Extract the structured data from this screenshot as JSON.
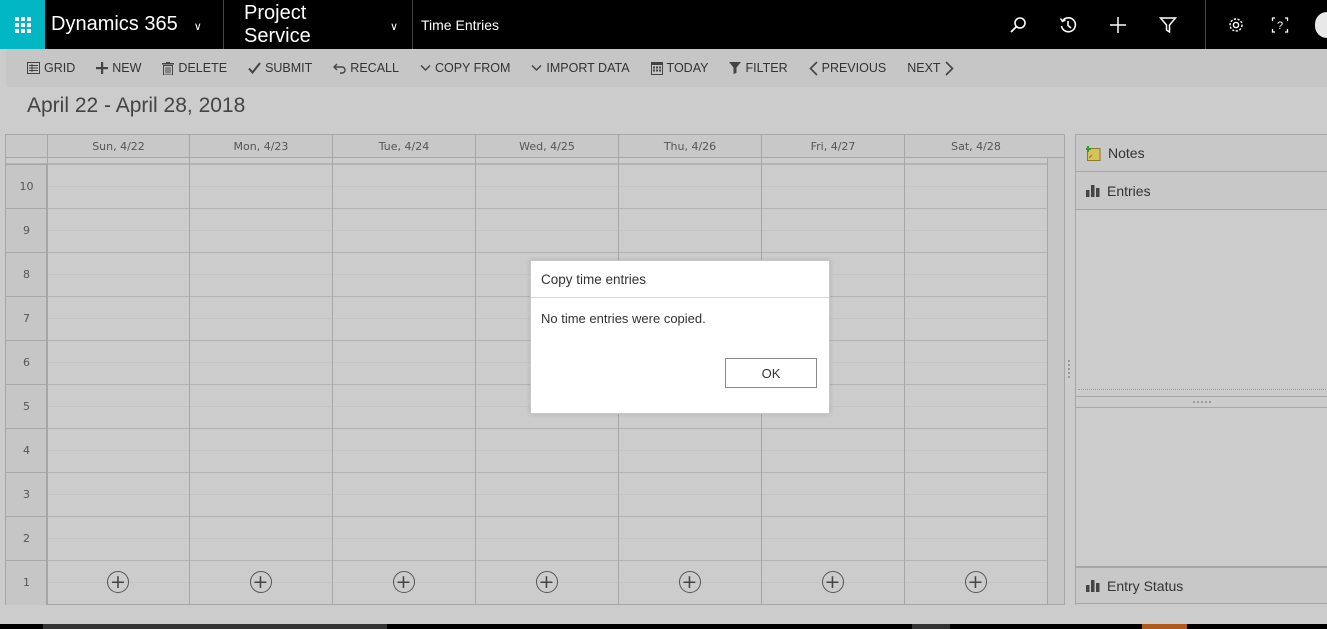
{
  "topbar": {
    "brand": "Dynamics 365",
    "app": "Project Service",
    "area": "Time Entries",
    "icons": [
      "search-icon",
      "recent-history-icon",
      "quick-create-plus-icon",
      "advanced-find-filter-icon",
      "settings-gear-icon",
      "help-icon",
      "user-avatar"
    ]
  },
  "commandbar": {
    "items": [
      {
        "label": "GRID",
        "icon": "grid-view-icon"
      },
      {
        "label": "NEW",
        "icon": "plus-icon"
      },
      {
        "label": "DELETE",
        "icon": "trash-icon"
      },
      {
        "label": "SUBMIT",
        "icon": "checkmark-icon"
      },
      {
        "label": "RECALL",
        "icon": "undo-arrow-icon"
      },
      {
        "label": "COPY FROM",
        "icon": "chevron-down-icon"
      },
      {
        "label": "IMPORT DATA",
        "icon": "chevron-down-icon"
      },
      {
        "label": "TODAY",
        "icon": "calendar-icon"
      },
      {
        "label": "FILTER",
        "icon": "funnel-icon"
      },
      {
        "label": "PREVIOUS",
        "icon": "chevron-left-icon"
      },
      {
        "label": "NEXT",
        "icon": "chevron-right-icon"
      }
    ]
  },
  "calendar": {
    "range_title": "April 22 - April 28, 2018",
    "days": [
      "Sun, 4/22",
      "Mon, 4/23",
      "Tue, 4/24",
      "Wed, 4/25",
      "Thu, 4/26",
      "Fri, 4/27",
      "Sat, 4/28"
    ],
    "hours": [
      "10",
      "9",
      "8",
      "7",
      "6",
      "5",
      "4",
      "3",
      "2",
      "1"
    ],
    "add_entry_symbol": "+"
  },
  "side_panel": {
    "notes": "Notes",
    "entries": "Entries",
    "entry_status": "Entry Status"
  },
  "dialog": {
    "title": "Copy time entries",
    "message": "No time entries were copied.",
    "ok_label": "OK"
  }
}
